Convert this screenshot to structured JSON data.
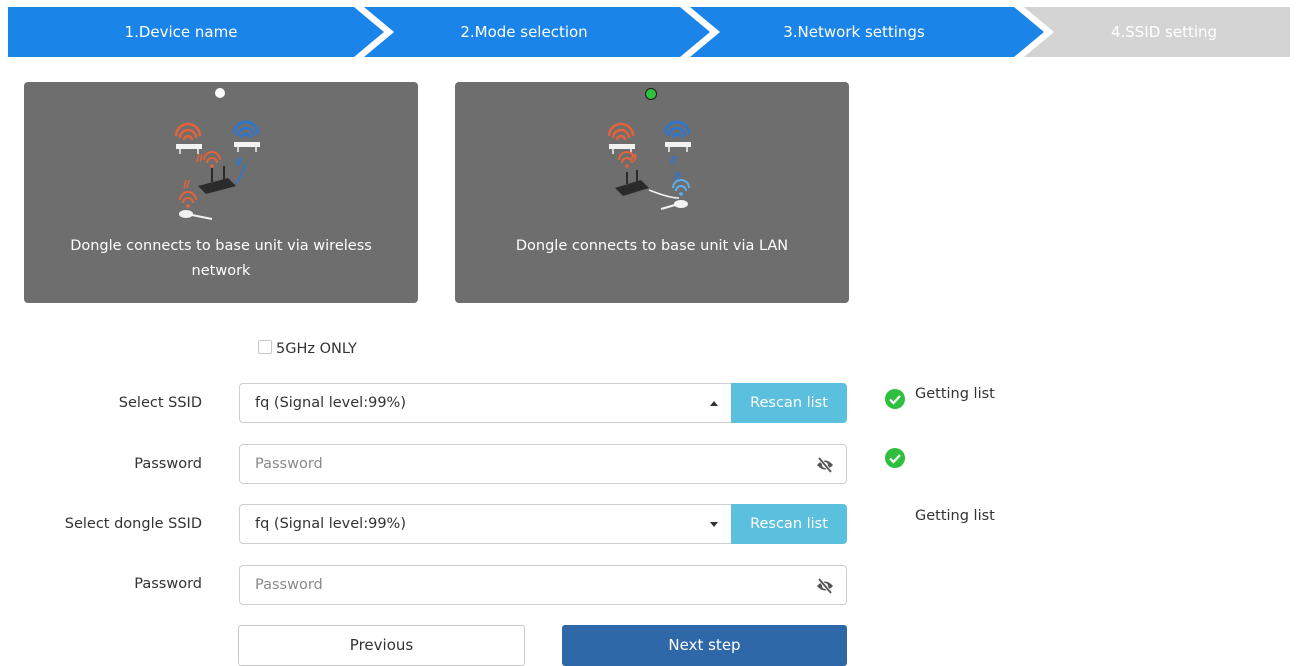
{
  "steps": [
    {
      "label": "1.Device name",
      "state": "done"
    },
    {
      "label": "2.Mode selection",
      "state": "done"
    },
    {
      "label": "3.Network settings",
      "state": "active"
    },
    {
      "label": "4.SSID setting",
      "state": "pending"
    }
  ],
  "colors": {
    "step_active": "#1a84e8",
    "step_pending": "#d4d4d4",
    "card_bg": "#6e6e6e",
    "rescan": "#5bc0de",
    "primary": "#2f68a8",
    "success": "#2ebf3f"
  },
  "modes": [
    {
      "caption": "Dongle connects to base unit via wireless network",
      "selected": false
    },
    {
      "caption": "Dongle connects to base unit via LAN",
      "selected": true
    }
  ],
  "form": {
    "five_ghz_label": "5GHz ONLY",
    "five_ghz_checked": false,
    "ssid": {
      "label": "Select SSID",
      "value": "fq (Signal level:99%)",
      "rescan": "Rescan list",
      "status": "Getting list"
    },
    "password": {
      "label": "Password",
      "placeholder": "Password"
    },
    "dongle_ssid": {
      "label": "Select dongle SSID",
      "value": "fq (Signal level:99%)",
      "rescan": "Rescan list",
      "status": "Getting list"
    },
    "dongle_password": {
      "label": "Password",
      "placeholder": "Password"
    }
  },
  "buttons": {
    "previous": "Previous",
    "next": "Next step"
  }
}
